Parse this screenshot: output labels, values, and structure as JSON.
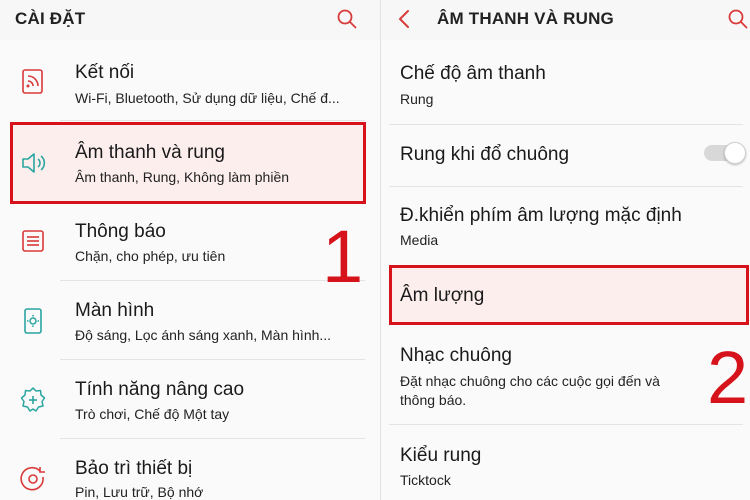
{
  "colors": {
    "accent": "#d6121b",
    "icon_teal": "#2aa5a0",
    "icon_red": "#d93a3a"
  },
  "left_screen": {
    "header": {
      "title": "CÀI ĐẶT"
    },
    "items": [
      {
        "title": "Kết nối",
        "subtitle": "Wi-Fi, Bluetooth, Sử dụng dữ liệu, Chế đ...",
        "icon": "wifi-icon"
      },
      {
        "title": "Âm thanh và rung",
        "subtitle": "Âm thanh, Rung, Không làm phiền",
        "icon": "speaker-icon"
      },
      {
        "title": "Thông báo",
        "subtitle": "Chặn, cho phép, ưu tiên",
        "icon": "notification-icon"
      },
      {
        "title": "Màn hình",
        "subtitle": "Độ sáng, Lọc ánh sáng xanh, Màn hình...",
        "icon": "display-icon"
      },
      {
        "title": "Tính năng nâng cao",
        "subtitle": "Trò chơi, Chế độ Một tay",
        "icon": "advanced-features-icon"
      },
      {
        "title": "Bảo trì thiết bị",
        "subtitle": "Pin, Lưu trữ, Bộ nhớ",
        "icon": "device-maintenance-icon"
      }
    ],
    "step_label": "1"
  },
  "right_screen": {
    "header": {
      "title": "ÂM THANH VÀ RUNG"
    },
    "items": [
      {
        "title": "Chế độ âm thanh",
        "subtitle": "Rung"
      },
      {
        "title": "Rung khi đổ chuông",
        "toggle": "off"
      },
      {
        "title": "Đ.khiển phím âm lượng mặc định",
        "subtitle": "Media"
      },
      {
        "title": "Âm lượng"
      },
      {
        "title": "Nhạc chuông",
        "subtitle_line1": "Đặt nhạc chuông cho các cuộc gọi đến và",
        "subtitle_line2": "thông báo."
      },
      {
        "title": "Kiểu rung",
        "subtitle": "Ticktock"
      }
    ],
    "step_label": "2"
  }
}
